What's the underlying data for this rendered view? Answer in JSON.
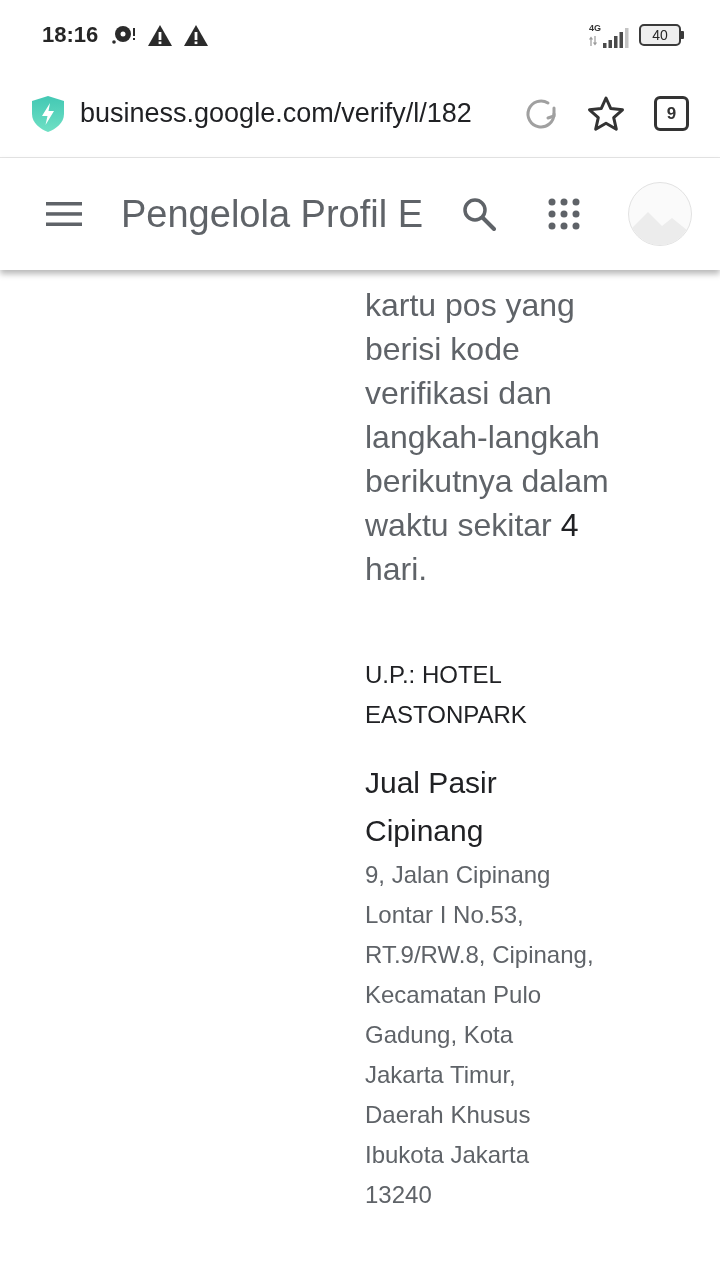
{
  "status_bar": {
    "time": "18:16",
    "network_type": "4G",
    "battery": "40"
  },
  "browser_bar": {
    "url": "business.google.com/verify/l/182",
    "tab_count": "9"
  },
  "app_bar": {
    "title": "Pengelola Profil E"
  },
  "content": {
    "paragraph": "kartu pos yang berisi kode verifikasi dan langkah-langkah berikutnya dalam waktu sekitar **4** hari.",
    "recipient": "U.P.: HOTEL EASTONPARK",
    "business_name": "Jual Pasir Cipinang",
    "address": "9, Jalan Cipinang\nLontar I No.53,\nRT.9/RW.8, Cipinang,\nKecamatan Pulo\nGadung, Kota\nJakarta Timur,\nDaerah Khusus\nIbukota Jakarta\n13240"
  }
}
